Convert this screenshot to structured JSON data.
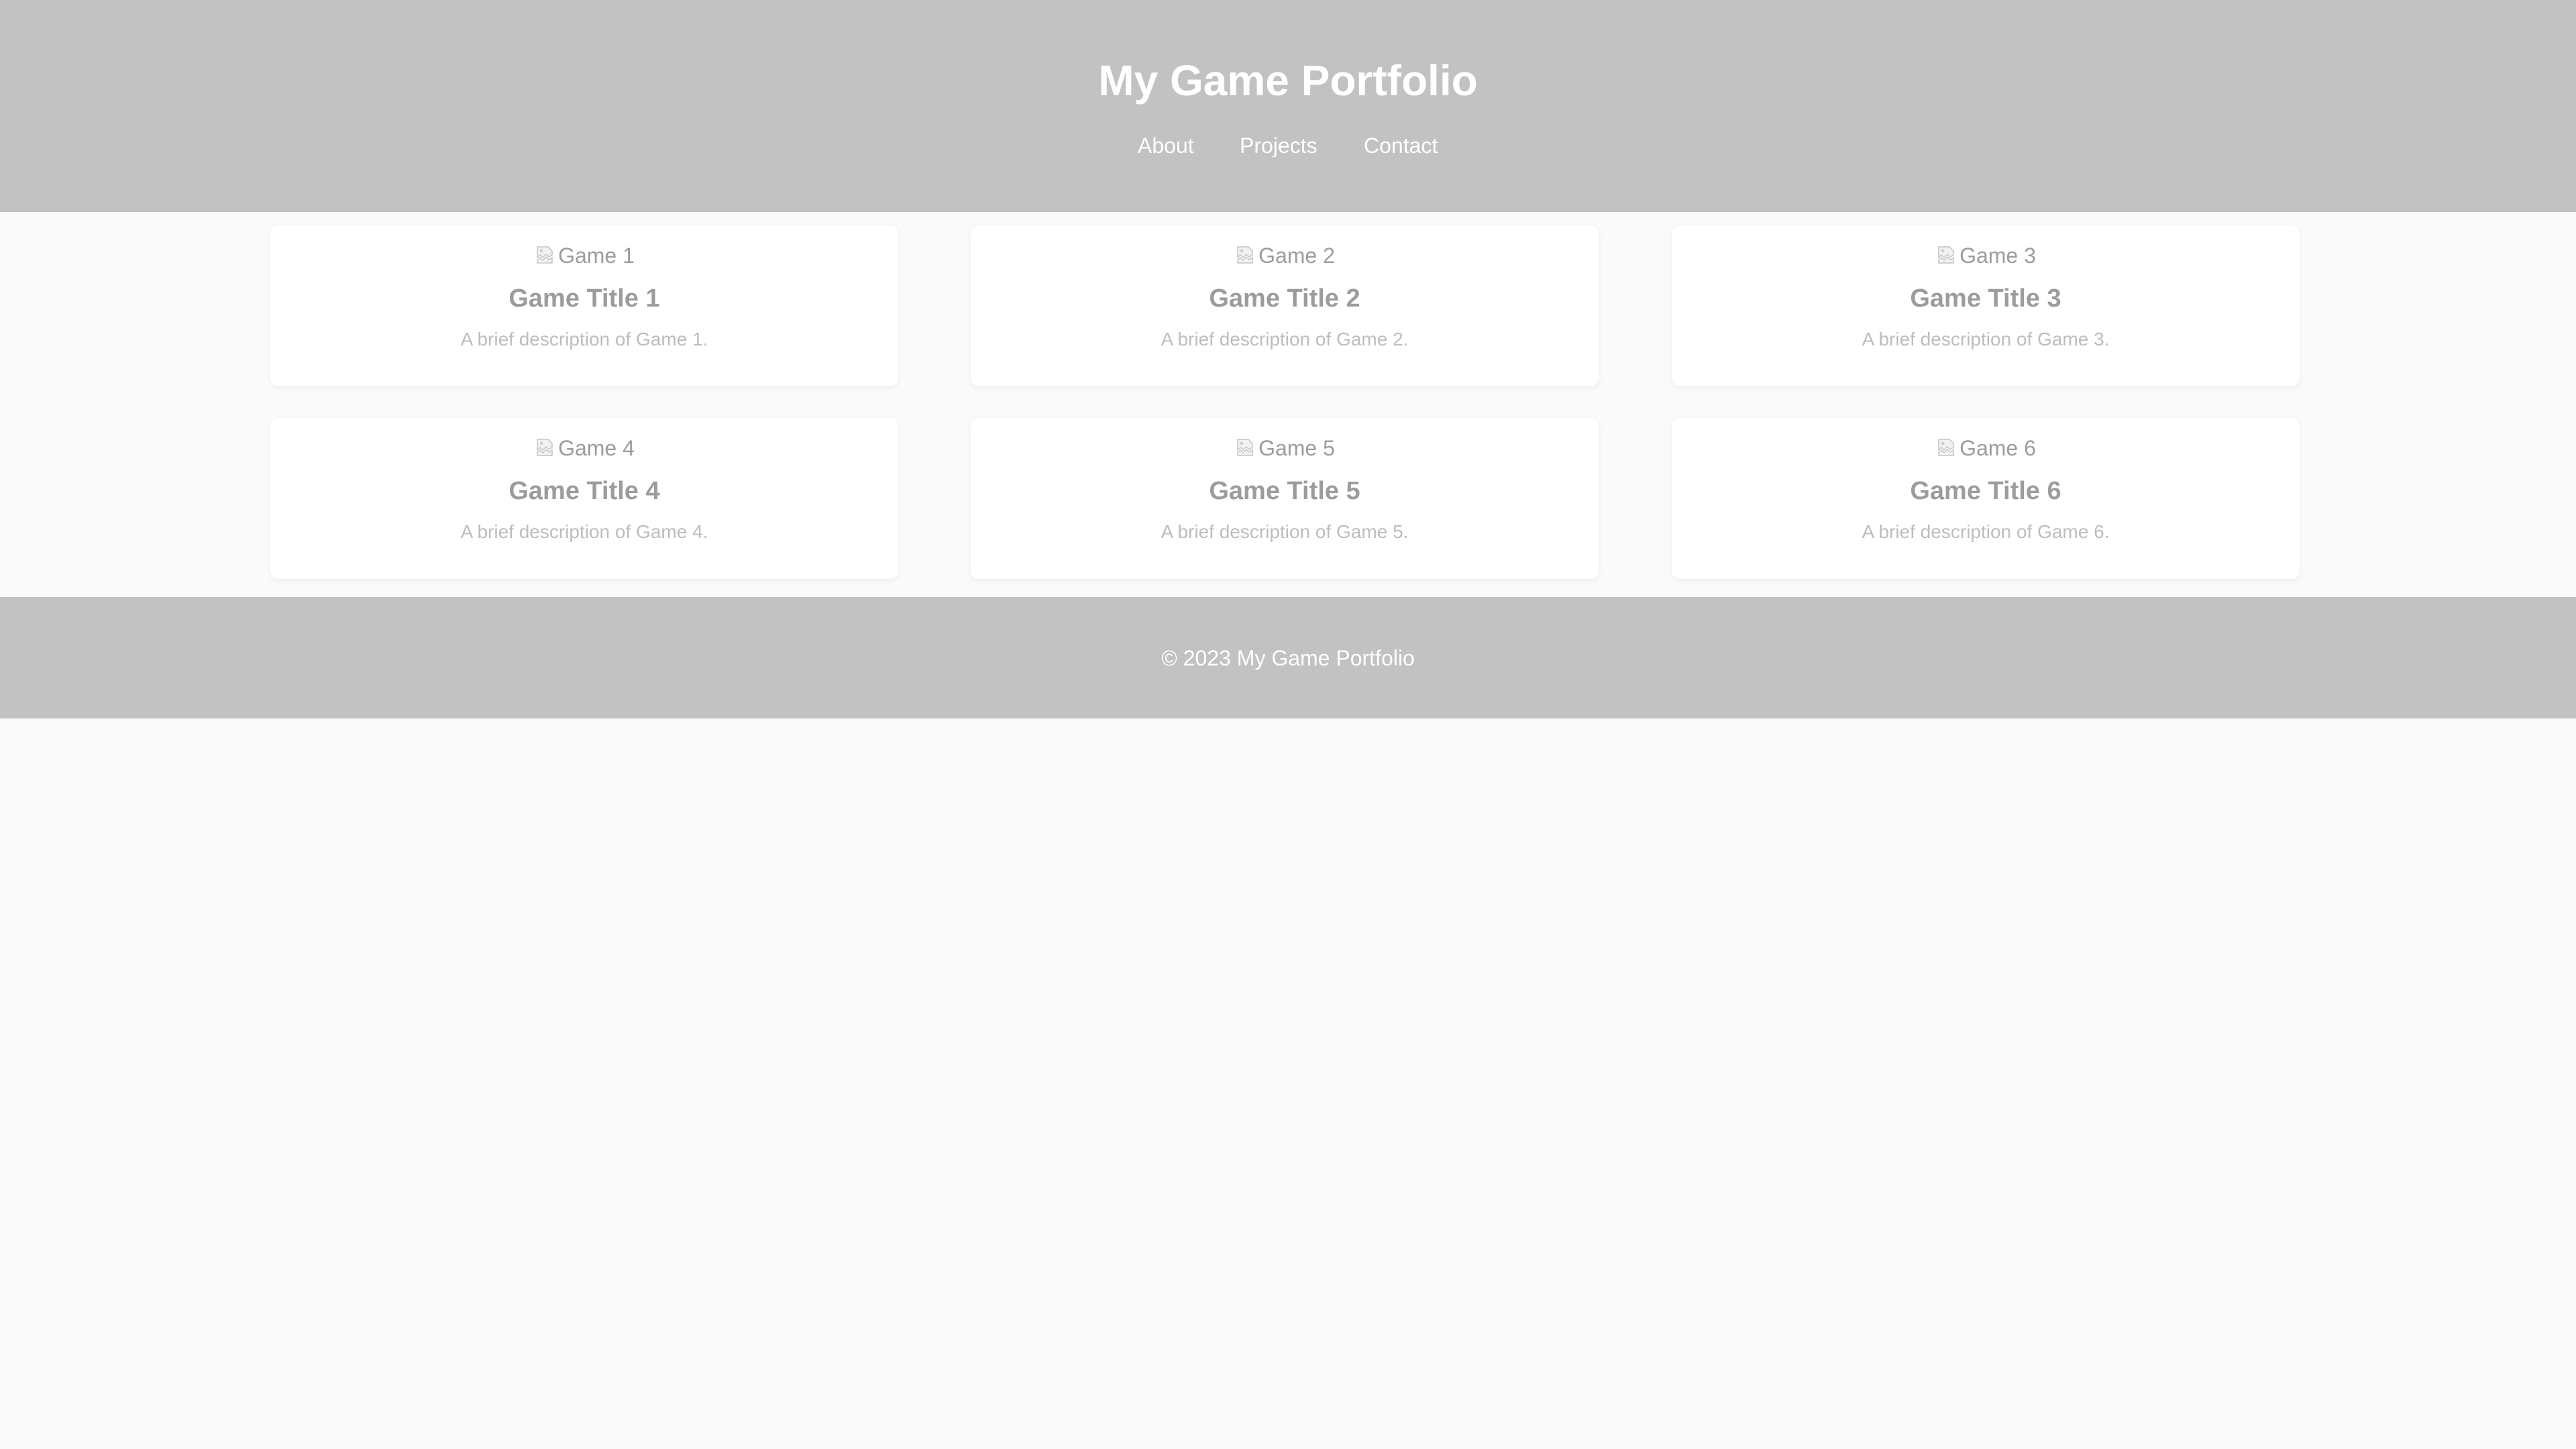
{
  "header": {
    "title": "My Game Portfolio",
    "nav": {
      "about": "About",
      "projects": "Projects",
      "contact": "Contact"
    }
  },
  "games": [
    {
      "image_alt": "Game 1",
      "title": "Game Title 1",
      "description": "A brief description of Game 1."
    },
    {
      "image_alt": "Game 2",
      "title": "Game Title 2",
      "description": "A brief description of Game 2."
    },
    {
      "image_alt": "Game 3",
      "title": "Game Title 3",
      "description": "A brief description of Game 3."
    },
    {
      "image_alt": "Game 4",
      "title": "Game Title 4",
      "description": "A brief description of Game 4."
    },
    {
      "image_alt": "Game 5",
      "title": "Game Title 5",
      "description": "A brief description of Game 5."
    },
    {
      "image_alt": "Game 6",
      "title": "Game Title 6",
      "description": "A brief description of Game 6."
    }
  ],
  "footer": {
    "text": "© 2023 My Game Portfolio"
  },
  "colors": {
    "header_bg": "#c2c2c2",
    "footer_bg": "#c2c2c2",
    "page_bg": "#fafafa",
    "card_bg": "#ffffff",
    "card_title": "#9c9c9c",
    "card_description": "#bdbdbd",
    "header_text": "#ffffff"
  },
  "icons": {
    "card_image": "broken-image-icon"
  }
}
